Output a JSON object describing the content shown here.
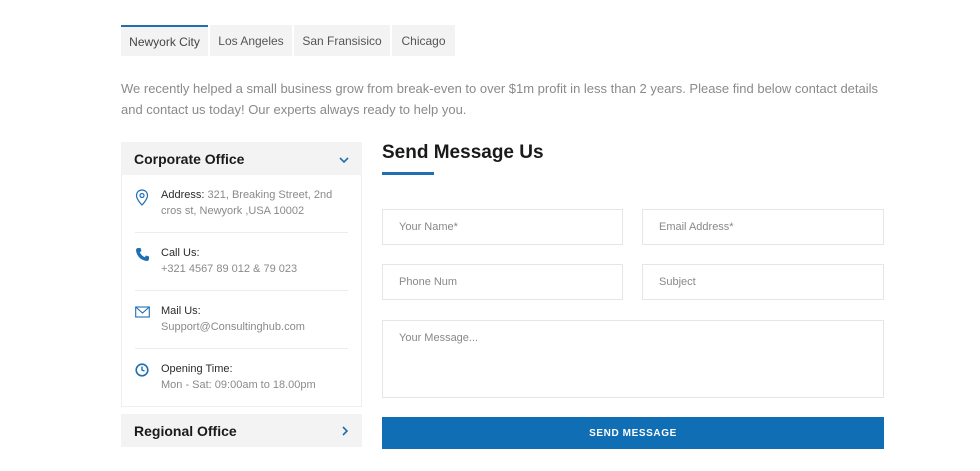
{
  "tabs": [
    {
      "label": "Newyork City",
      "active": true
    },
    {
      "label": "Los Angeles"
    },
    {
      "label": "San Fransisico"
    },
    {
      "label": "Chicago"
    }
  ],
  "intro_text": "We recently helped a small business grow from break-even to over $1m profit in less than 2 years. Please find below contact details and contact us today! Our experts always ready to help you.",
  "corporate_office": {
    "title": "Corporate Office",
    "address_label": "Address:",
    "address_value": " 321, Breaking Street, 2nd cros st, Newyork ,USA 10002",
    "call_label": "Call Us:",
    "call_value": "+321 4567 89 012 & 79 023",
    "mail_label": "Mail Us:",
    "mail_value": "Support@Consultinghub.com",
    "time_label": "Opening Time:",
    "time_value": "Mon - Sat: 09:00am to 18.00pm"
  },
  "regional_office": {
    "title": "Regional Office"
  },
  "form": {
    "title": "Send Message Us",
    "name_placeholder": "Your Name*",
    "email_placeholder": "Email Address*",
    "phone_placeholder": "Phone Num",
    "subject_placeholder": "Subject",
    "message_placeholder": "Your Message...",
    "submit_label": "SEND MESSAGE"
  },
  "colors": {
    "accent": "#106eb5",
    "tab_bg": "#f3f3f3"
  },
  "icons": {
    "address": "map-pin-icon",
    "call": "phone-icon",
    "mail": "envelope-icon",
    "time": "clock-icon",
    "expand": "chevron-down-icon",
    "collapsed": "chevron-right-icon"
  }
}
